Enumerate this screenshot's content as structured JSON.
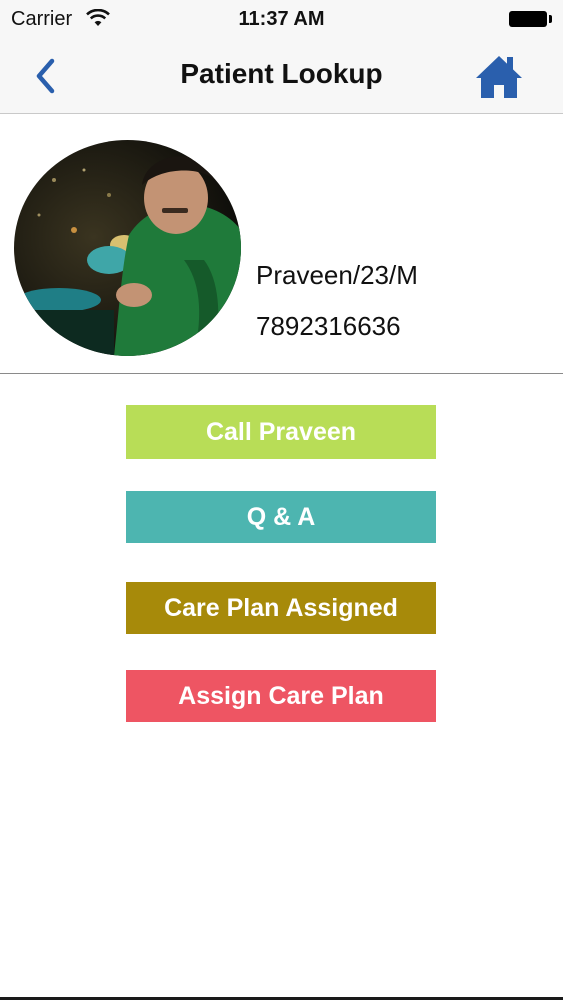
{
  "status_bar": {
    "carrier": "Carrier",
    "time": "11:37 AM",
    "icons": [
      "wifi-icon",
      "battery-icon"
    ]
  },
  "nav": {
    "title": "Patient Lookup",
    "back_icon": "chevron-left-icon",
    "home_icon": "home-icon",
    "accent_color": "#2a5fad"
  },
  "patient": {
    "name_line": "Praveen/23/M",
    "phone": "7892316636",
    "avatar": "patient-photo"
  },
  "actions": [
    {
      "label": "Call Praveen",
      "color": "#b8dd57"
    },
    {
      "label": "Q & A",
      "color": "#4db5b0"
    },
    {
      "label": "Care Plan Assigned",
      "color": "#a78a0a"
    },
    {
      "label": "Assign Care Plan",
      "color": "#ee5563"
    }
  ]
}
